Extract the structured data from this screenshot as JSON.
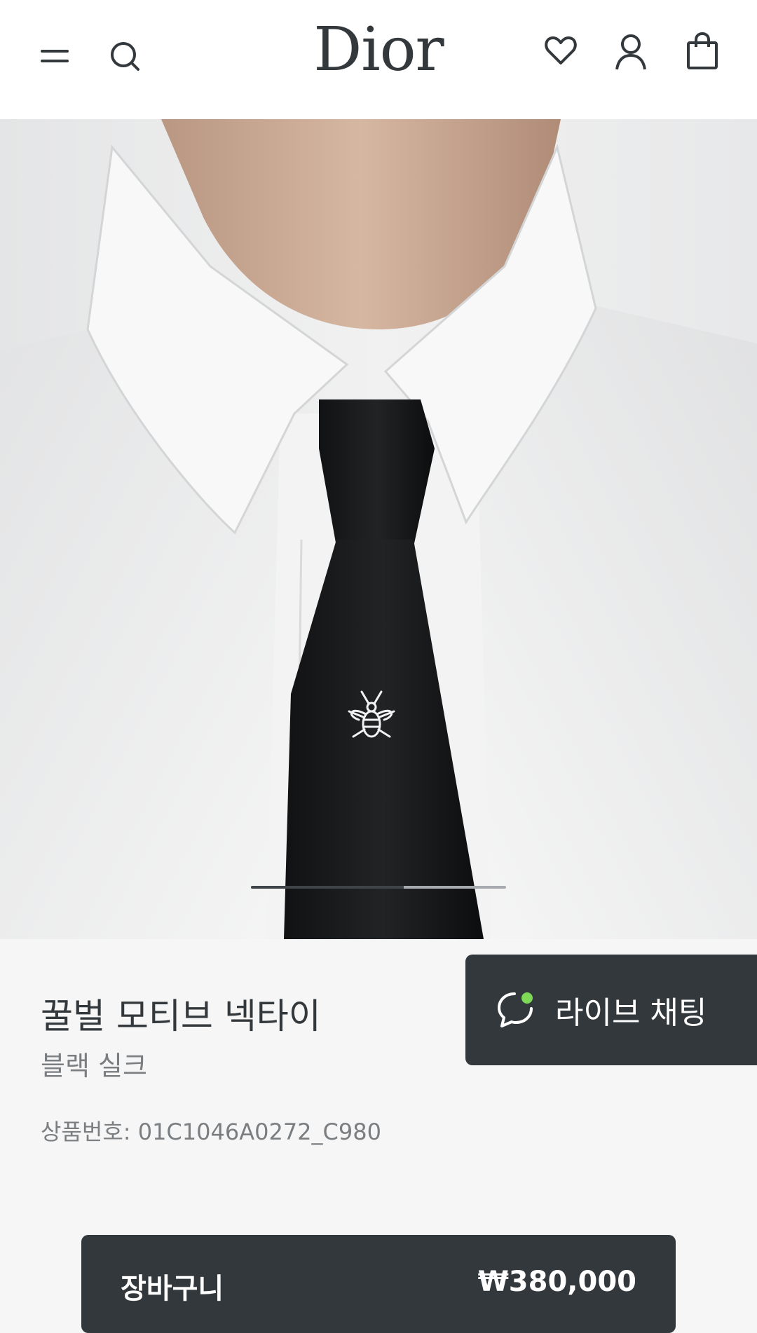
{
  "header": {
    "logo": "Dior",
    "icons": [
      "menu-icon",
      "search-icon",
      "heart-icon",
      "user-icon",
      "shopping-bag-icon"
    ]
  },
  "hero": {
    "carousel_progress": 0.6
  },
  "product": {
    "title": "꿀벌 모티브 넥타이",
    "subtitle": "블랙 실크",
    "sku": "상품번호: 01C1046A0272_C980"
  },
  "chat": {
    "label": "라이브 채팅",
    "status_color": "#7ed957"
  },
  "cart": {
    "label": "장바구니",
    "price": "₩380,000"
  },
  "colors": {
    "dark": "#33383c",
    "background": "#f6f6f6",
    "muted_text": "#7b7e81"
  }
}
